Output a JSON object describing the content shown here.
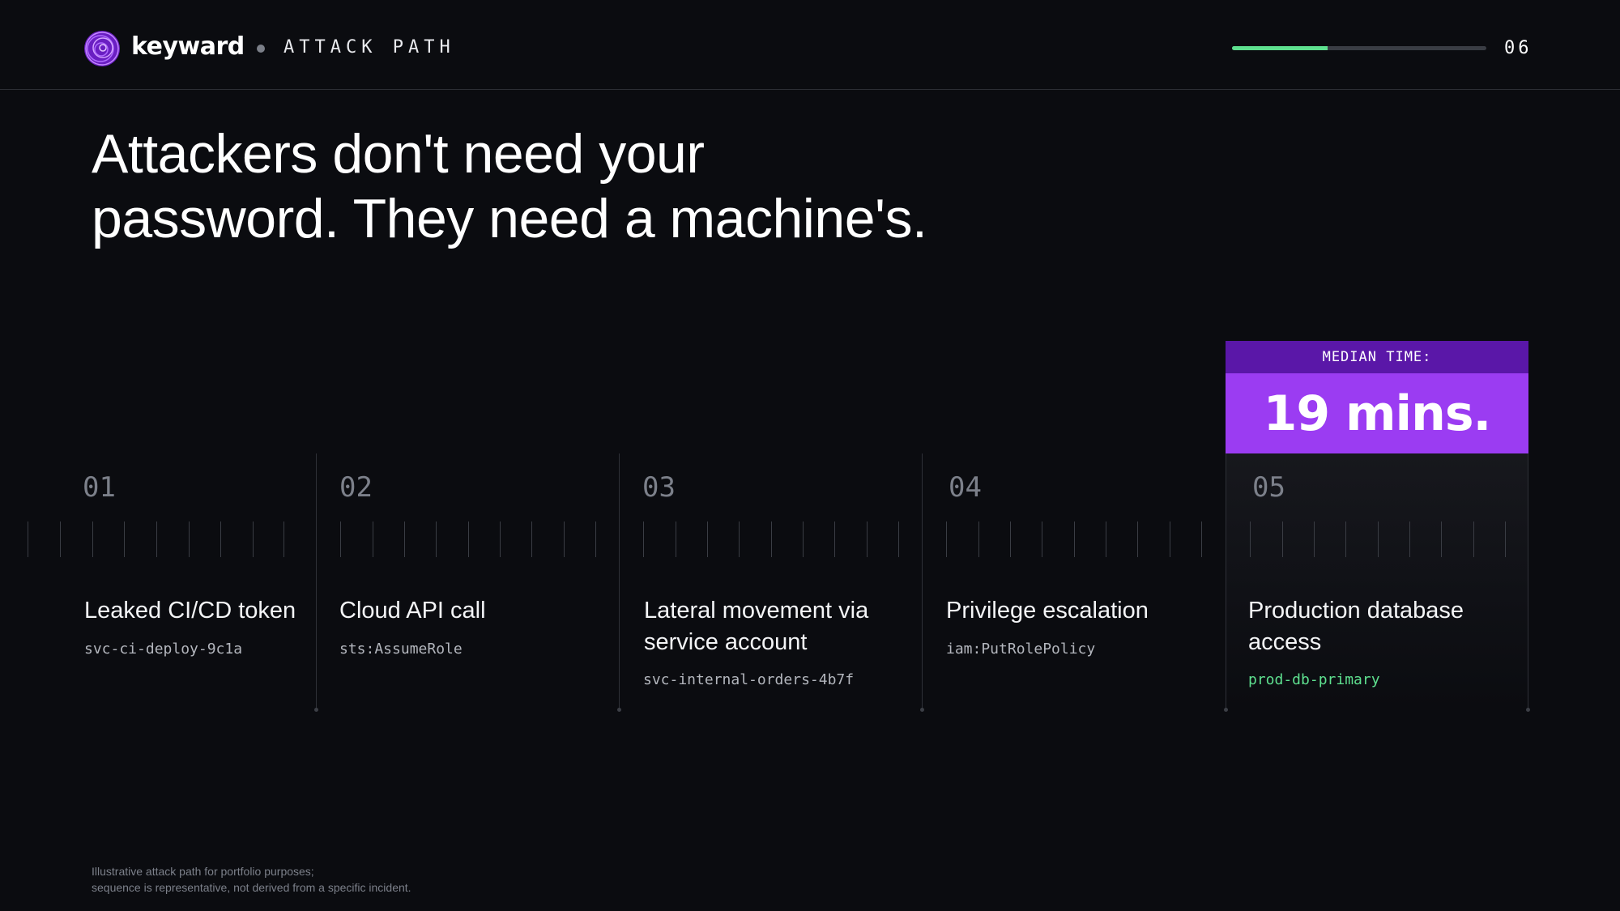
{
  "header": {
    "brand": "keyward",
    "section_label": "ATTACK PATH",
    "progress_fraction": 0.375,
    "page_number": "06",
    "colors": {
      "accent_green": "#5ee08f",
      "brand_purple": "#9b3cf2"
    }
  },
  "headline": {
    "line1": "Attackers don't need your",
    "line2": "password. They need a machine's."
  },
  "callout": {
    "label": "MEDIAN TIME:",
    "value": "19 mins."
  },
  "steps": [
    {
      "number": "01",
      "title_line1": "Leaked CI/CD token",
      "title_line2": "",
      "identifier": "svc-ci-deploy-9c1a"
    },
    {
      "number": "02",
      "title_line1": "Cloud API call",
      "title_line2": "",
      "identifier": "sts:AssumeRole"
    },
    {
      "number": "03",
      "title_line1": "Lateral movement via",
      "title_line2": "service account",
      "identifier": "svc-internal-orders-4b7f"
    },
    {
      "number": "04",
      "title_line1": "Privilege escalation",
      "title_line2": "",
      "identifier": "iam:PutRolePolicy"
    },
    {
      "number": "05",
      "title_line1": "Production database",
      "title_line2": "access",
      "identifier": "prod-db-primary"
    }
  ],
  "footnote": {
    "line1": "Illustrative attack path for portfolio purposes;",
    "line2": "sequence is representative, not derived from a specific incident."
  }
}
